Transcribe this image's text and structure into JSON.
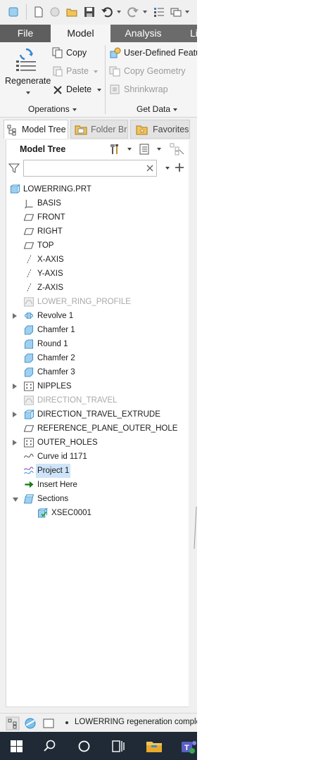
{
  "ribbon_tabs": {
    "file": "File",
    "model": "Model",
    "analysis": "Analysis",
    "partial": "Li"
  },
  "operations": {
    "regenerate": "Regenerate",
    "copy": "Copy",
    "paste": "Paste",
    "delete": "Delete",
    "group_label": "Operations"
  },
  "get_data": {
    "user_defined_feature": "User-Defined Featu",
    "copy_geometry": "Copy Geometry",
    "shrinkwrap": "Shrinkwrap",
    "group_label": "Get Data"
  },
  "panel_tabs": {
    "model_tree": "Model Tree",
    "folder_browser": "Folder Br",
    "favorites": "Favorites"
  },
  "model_tree": {
    "title": "Model Tree",
    "filter_placeholder": "",
    "items": [
      {
        "label": "LOWERRING.PRT",
        "icon": "part-icon"
      },
      {
        "label": "BASIS",
        "icon": "csys-icon"
      },
      {
        "label": "FRONT",
        "icon": "datum-plane-icon"
      },
      {
        "label": "RIGHT",
        "icon": "datum-plane-icon"
      },
      {
        "label": "TOP",
        "icon": "datum-plane-icon"
      },
      {
        "label": "X-AXIS",
        "icon": "datum-axis-icon"
      },
      {
        "label": "Y-AXIS",
        "icon": "datum-axis-icon"
      },
      {
        "label": "Z-AXIS",
        "icon": "datum-axis-icon"
      },
      {
        "label": "LOWER_RING_PROFILE",
        "icon": "sketch-icon",
        "suppressed": true
      },
      {
        "label": "Revolve 1",
        "icon": "revolve-icon",
        "expandable": true
      },
      {
        "label": "Chamfer 1",
        "icon": "chamfer-icon"
      },
      {
        "label": "Round 1",
        "icon": "round-icon"
      },
      {
        "label": "Chamfer 2",
        "icon": "chamfer-icon"
      },
      {
        "label": "Chamfer 3",
        "icon": "chamfer-icon"
      },
      {
        "label": "NIPPLES",
        "icon": "pattern-icon",
        "expandable": true
      },
      {
        "label": "DIRECTION_TRAVEL",
        "icon": "sketch-icon",
        "suppressed": true
      },
      {
        "label": "DIRECTION_TRAVEL_EXTRUDE",
        "icon": "extrude-icon",
        "expandable": true
      },
      {
        "label": "REFERENCE_PLANE_OUTER_HOLE",
        "icon": "datum-plane-icon"
      },
      {
        "label": "OUTER_HOLES",
        "icon": "pattern-icon",
        "expandable": true
      },
      {
        "label": "Curve id 1171",
        "icon": "curve-icon"
      },
      {
        "label": "Project 1",
        "icon": "project-curve-icon",
        "selected": true
      },
      {
        "label": "Insert Here",
        "icon": "insert-arrow-icon"
      },
      {
        "label": "Sections",
        "icon": "sections-folder-icon",
        "expanded": true
      },
      {
        "label": "XSEC0001",
        "icon": "xsec-icon",
        "child": true
      }
    ]
  },
  "status": {
    "message": "LOWERRING regeneration comple"
  },
  "colors": {
    "tab_bar": "#6b6b6b",
    "selection": "#cfe4f8",
    "taskbar": "#1f2a36",
    "icon_blue": "#2b88d8"
  }
}
